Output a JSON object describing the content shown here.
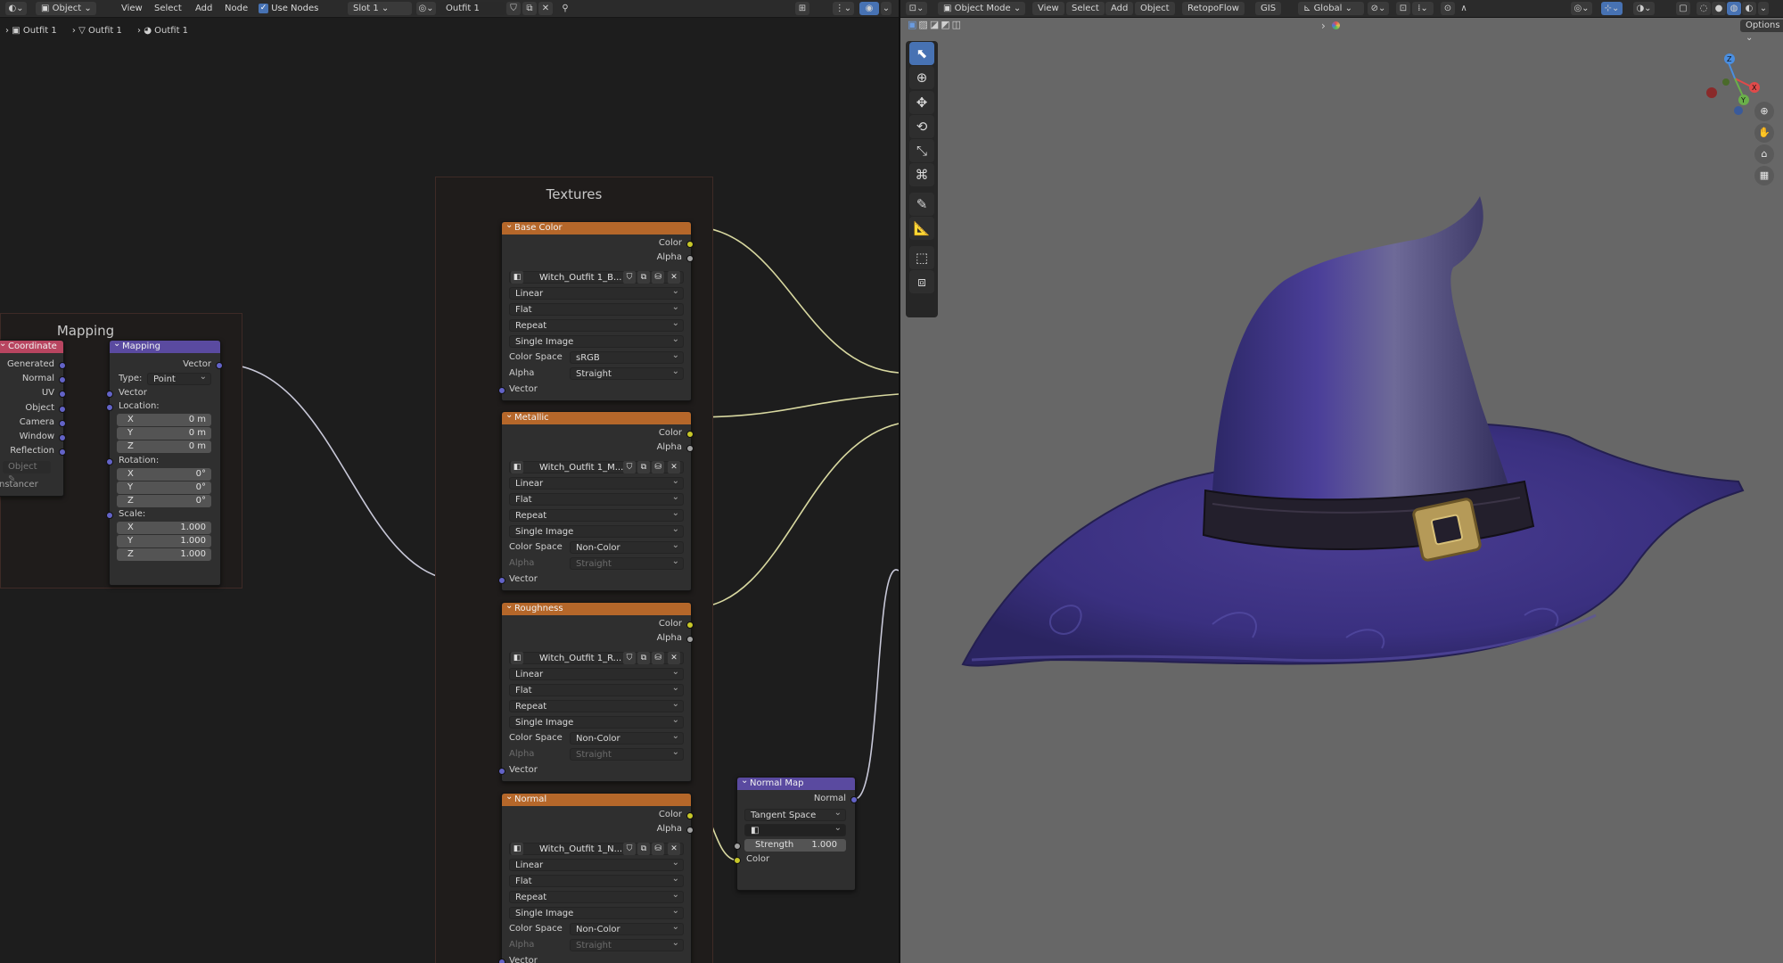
{
  "node_header": {
    "editor_type": "Object",
    "menus": [
      "View",
      "Select",
      "Add",
      "Node"
    ],
    "use_nodes_label": "Use Nodes",
    "slot": "Slot 1",
    "material": "Outfit 1"
  },
  "breadcrumb": [
    "Outfit 1",
    "Outfit 1",
    "Outfit 1"
  ],
  "frames": {
    "mapping": "Mapping",
    "textures": "Textures"
  },
  "texcoord": {
    "title": "Coordinate",
    "outputs": [
      "Generated",
      "Normal",
      "UV",
      "Object",
      "Camera",
      "Window",
      "Reflection"
    ],
    "object_field": "Object",
    "instancer": "nstancer"
  },
  "mapping": {
    "title": "Mapping",
    "out_vector": "Vector",
    "type_label": "Type:",
    "type_value": "Point",
    "in_vector": "Vector",
    "location_label": "Location:",
    "location": [
      {
        "axis": "X",
        "value": "0 m"
      },
      {
        "axis": "Y",
        "value": "0 m"
      },
      {
        "axis": "Z",
        "value": "0 m"
      }
    ],
    "rotation_label": "Rotation:",
    "rotation": [
      {
        "axis": "X",
        "value": "0°"
      },
      {
        "axis": "Y",
        "value": "0°"
      },
      {
        "axis": "Z",
        "value": "0°"
      }
    ],
    "scale_label": "Scale:",
    "scale": [
      {
        "axis": "X",
        "value": "1.000"
      },
      {
        "axis": "Y",
        "value": "1.000"
      },
      {
        "axis": "Z",
        "value": "1.000"
      }
    ]
  },
  "textures": [
    {
      "title": "Base Color",
      "out_color": "Color",
      "out_alpha": "Alpha",
      "image": "Witch_Outfit 1_B...",
      "interp": "Linear",
      "proj": "Flat",
      "ext": "Repeat",
      "source": "Single Image",
      "cs_label": "Color Space",
      "color_space": "sRGB",
      "alpha_label": "Alpha",
      "alpha": "Straight",
      "in_vector": "Vector"
    },
    {
      "title": "Metallic",
      "out_color": "Color",
      "out_alpha": "Alpha",
      "image": "Witch_Outfit 1_M...",
      "interp": "Linear",
      "proj": "Flat",
      "ext": "Repeat",
      "source": "Single Image",
      "cs_label": "Color Space",
      "color_space": "Non-Color",
      "alpha_label": "Alpha",
      "alpha": "Straight",
      "in_vector": "Vector"
    },
    {
      "title": "Roughness",
      "out_color": "Color",
      "out_alpha": "Alpha",
      "image": "Witch_Outfit 1_R...",
      "interp": "Linear",
      "proj": "Flat",
      "ext": "Repeat",
      "source": "Single Image",
      "cs_label": "Color Space",
      "color_space": "Non-Color",
      "alpha_label": "Alpha",
      "alpha": "Straight",
      "in_vector": "Vector"
    },
    {
      "title": "Normal",
      "out_color": "Color",
      "out_alpha": "Alpha",
      "image": "Witch_Outfit 1_N...",
      "interp": "Linear",
      "proj": "Flat",
      "ext": "Repeat",
      "source": "Single Image",
      "cs_label": "Color Space",
      "color_space": "Non-Color",
      "alpha_label": "Alpha",
      "alpha": "Straight",
      "in_vector": "Vector"
    }
  ],
  "normal_map": {
    "title": "Normal Map",
    "out_normal": "Normal",
    "space": "Tangent Space",
    "strength_label": "Strength",
    "strength": "1.000",
    "in_color": "Color"
  },
  "viewport_header": {
    "mode": "Object Mode",
    "menus": [
      "View",
      "Select",
      "Add",
      "Object",
      "RetopoFlow",
      "GIS"
    ],
    "orientation": "Global",
    "options": "Options"
  },
  "gizmo": {
    "x": "X",
    "y": "Y",
    "z": "Z"
  },
  "colors": {
    "texture_header": "#b5672a",
    "vector_header": "#5a4aa0",
    "input_header": "#b84560",
    "hat": "#3c2f7a",
    "viewport_bg": "#676767"
  }
}
